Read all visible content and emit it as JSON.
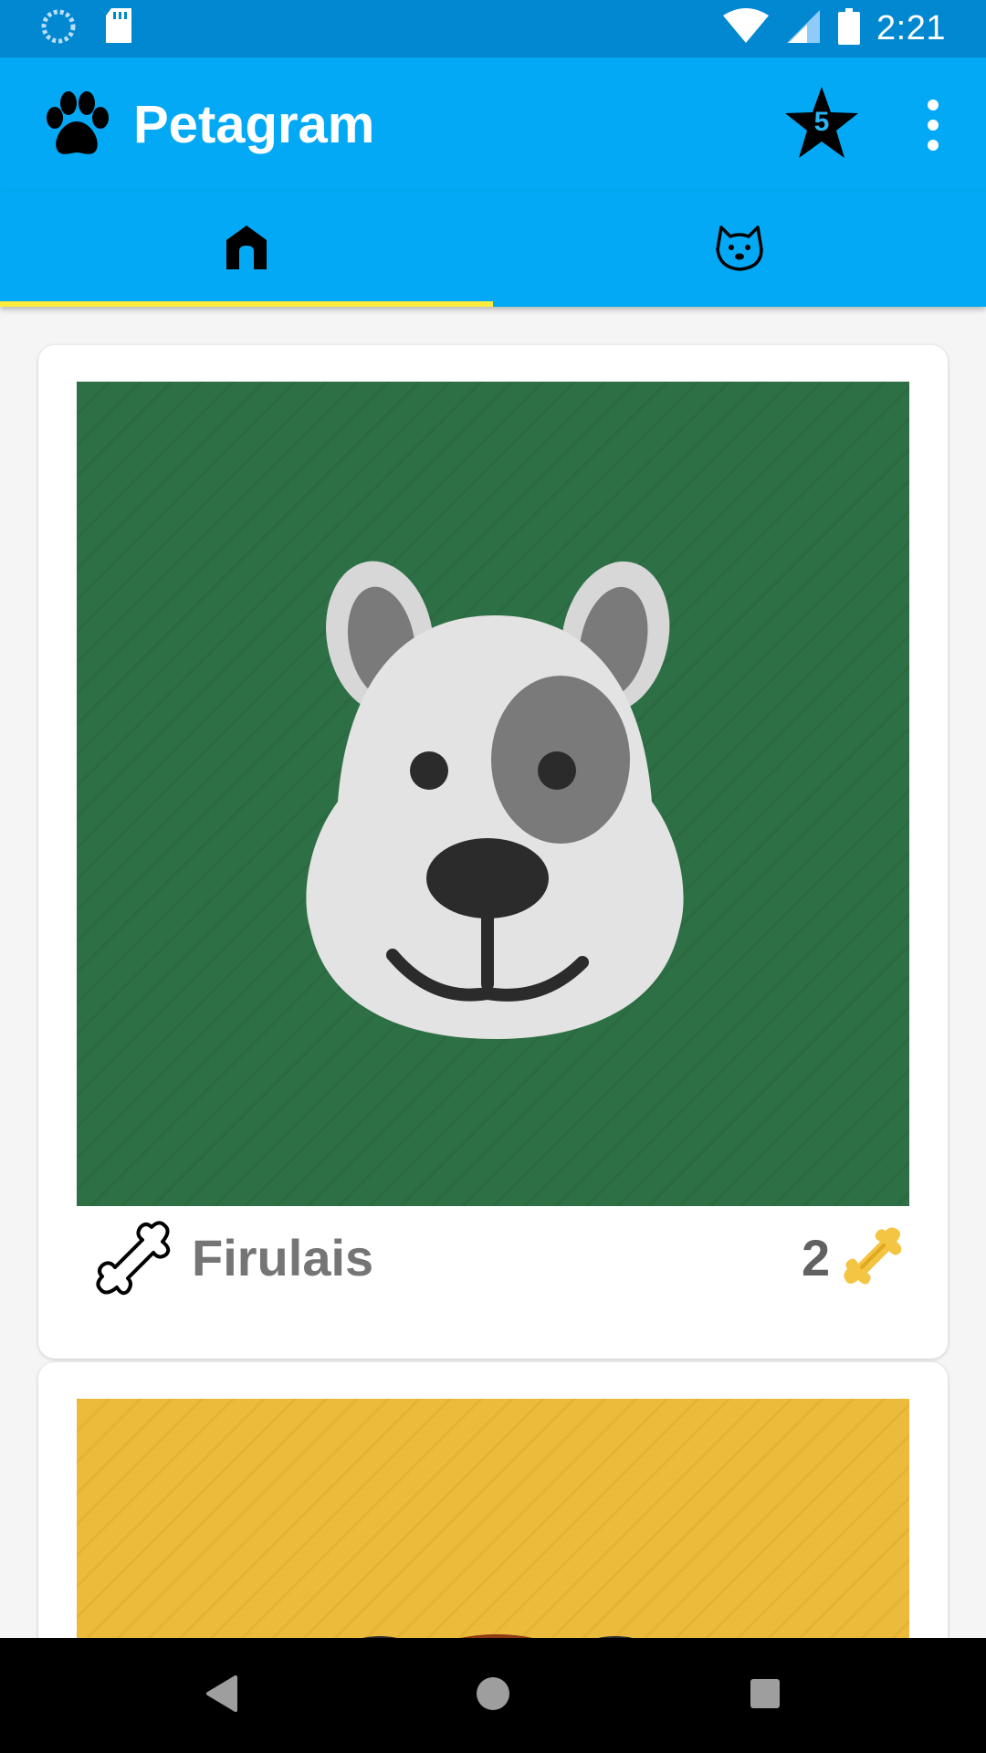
{
  "status_bar": {
    "time": "2:21",
    "icons": [
      "loading-icon",
      "sd-card-icon",
      "wifi-icon",
      "signal-icon",
      "battery-icon"
    ]
  },
  "app_bar": {
    "title": "Petagram",
    "logo_icon": "paw-icon",
    "favorites_count": "5",
    "menu_icon": "more-vert-icon"
  },
  "tabs": [
    {
      "name": "home",
      "icon": "home-icon",
      "selected": true
    },
    {
      "name": "profile",
      "icon": "dog-face-icon",
      "selected": false
    }
  ],
  "pets": [
    {
      "name": "Firulais",
      "likes": "2",
      "photo_bg": "#2e7045",
      "photo": "dog-face-illustration"
    },
    {
      "name": "",
      "likes": "",
      "photo_bg": "#ecbb3c",
      "photo": "dog-face-illustration"
    }
  ],
  "colors": {
    "primary": "#03a9f4",
    "primary_dark": "#0288d1",
    "accent": "#ffeb3b",
    "bone_gold": "#f4c542"
  },
  "nav_bar": {
    "back_icon": "back-icon",
    "home_icon": "home-circle-icon",
    "recents_icon": "recents-icon"
  }
}
